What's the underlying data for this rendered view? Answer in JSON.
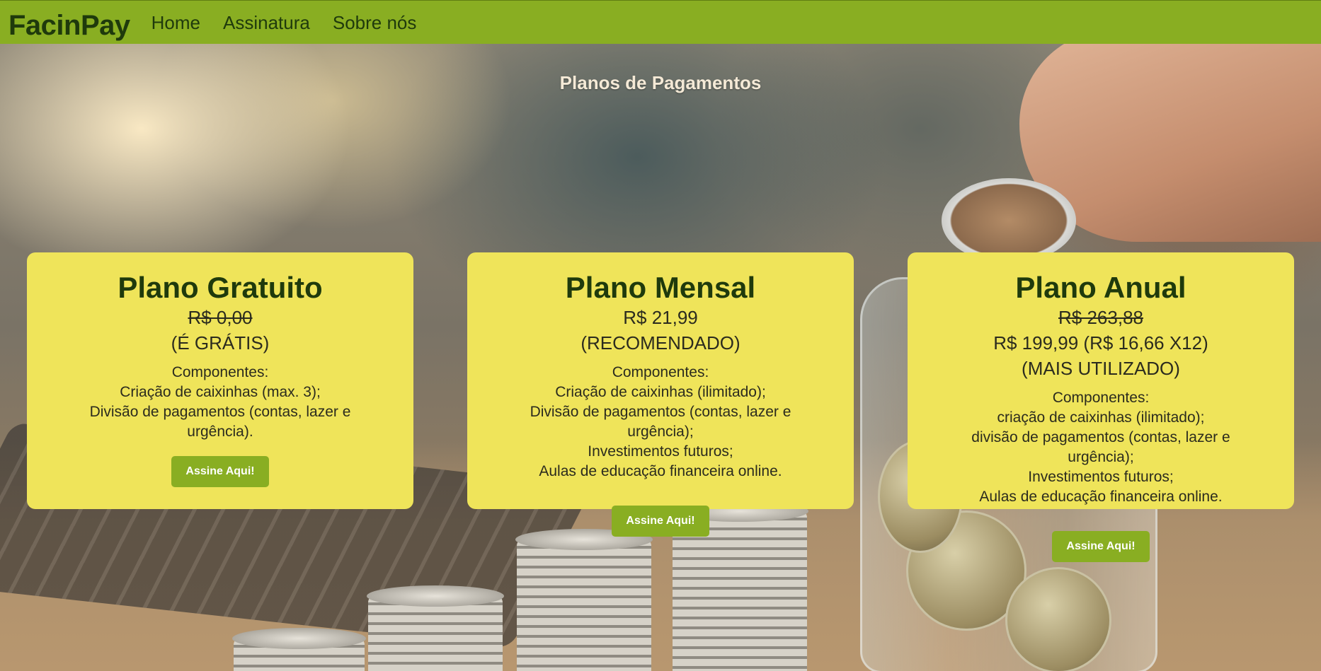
{
  "nav": {
    "brand": "FacinPay",
    "links": [
      "Home",
      "Assinatura",
      "Sobre nós"
    ]
  },
  "page": {
    "title": "Planos de Pagamentos"
  },
  "plans": [
    {
      "title": "Plano Gratuito",
      "price_old": "R$ 0,00",
      "price": "",
      "tag": "(É GRÁTIS)",
      "components_title": "Componentes:",
      "components": [
        "Criação de caixinhas (max. 3);",
        "Divisão de pagamentos (contas, lazer e urgência)."
      ],
      "cta": "Assine Aqui!"
    },
    {
      "title": "Plano Mensal",
      "price_old": "",
      "price": "R$ 21,99",
      "tag": "(RECOMENDADO)",
      "components_title": "Componentes:",
      "components": [
        "Criação de caixinhas (ilimitado);",
        "Divisão de pagamentos (contas, lazer e urgência);",
        "Investimentos futuros;",
        "Aulas de educação financeira online."
      ],
      "cta": "Assine Aqui!"
    },
    {
      "title": "Plano Anual",
      "price_old": "R$ 263,88",
      "price": "R$ 199,99 (R$ 16,66 X12)",
      "tag": "(MAIS UTILIZADO)",
      "components_title": "Componentes:",
      "components": [
        "criação de caixinhas (ilimitado);",
        "divisão de pagamentos (contas, lazer e urgência);",
        "Investimentos futuros;",
        "Aulas de educação financeira online."
      ],
      "cta": "Assine Aqui!"
    }
  ],
  "colors": {
    "nav_bg": "#89ae22",
    "card_bg": "#efe45a",
    "button_bg": "#89ae22",
    "text_dark_green": "#1f3a0c"
  },
  "icons": {
    "background": "coins-savings-photo"
  }
}
